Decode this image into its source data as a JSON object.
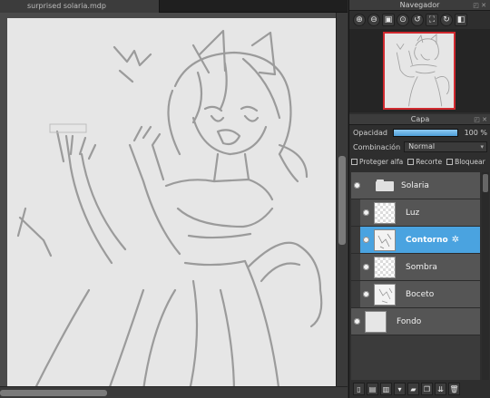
{
  "document": {
    "tab_title": "surprised solaria.mdp"
  },
  "navigator": {
    "title": "Navegador",
    "tools": [
      {
        "name": "zoom-in-icon",
        "glyph": "⊕"
      },
      {
        "name": "zoom-out-icon",
        "glyph": "⊖"
      },
      {
        "name": "fit-window-icon",
        "glyph": "▣"
      },
      {
        "name": "actual-size-icon",
        "glyph": "⊙"
      },
      {
        "name": "rotate-left-icon",
        "glyph": "↺"
      },
      {
        "name": "fullscreen-icon",
        "glyph": "⛶"
      },
      {
        "name": "rotate-right-icon",
        "glyph": "↻"
      },
      {
        "name": "flip-icon",
        "glyph": "◧"
      }
    ]
  },
  "capa": {
    "title": "Capa",
    "opacity_label": "Opacidad",
    "opacity_value": "100 %",
    "opacity_fraction": 1.0,
    "blend_label": "Combinación",
    "blend_value": "Normal",
    "checks": [
      {
        "label": "Proteger alfa",
        "name": "protect-alpha-checkbox"
      },
      {
        "label": "Recorte",
        "name": "clipping-checkbox"
      },
      {
        "label": "Bloquear",
        "name": "lock-checkbox"
      }
    ],
    "layers": [
      {
        "name": "Solaria",
        "type": "folder",
        "selected": false,
        "indent": false
      },
      {
        "name": "Luz",
        "type": "layer",
        "selected": false,
        "indent": true
      },
      {
        "name": "Contorno",
        "type": "layer",
        "selected": true,
        "indent": true
      },
      {
        "name": "Sombra",
        "type": "layer",
        "selected": false,
        "indent": true
      },
      {
        "name": "Boceto",
        "type": "layer",
        "selected": false,
        "indent": true
      },
      {
        "name": "Fondo",
        "type": "layer",
        "selected": false,
        "indent": false
      }
    ],
    "toolbar": [
      {
        "name": "new-layer-icon",
        "glyph": "▯"
      },
      {
        "name": "new-layer-menu-icon",
        "glyph": "▤"
      },
      {
        "name": "new-1bit-layer-icon",
        "glyph": "▥"
      },
      {
        "name": "add-layer-dropdown-icon",
        "glyph": "▾"
      },
      {
        "name": "new-folder-icon",
        "glyph": "▰"
      },
      {
        "name": "duplicate-layer-icon",
        "glyph": "❐"
      },
      {
        "name": "merge-layer-icon",
        "glyph": "⇊"
      },
      {
        "name": "delete-layer-icon",
        "glyph": "🗑"
      }
    ]
  },
  "colors": {
    "selected_layer": "#4aa3e0",
    "navigator_frame": "#d0292f",
    "opacity_fill": "#4f9fd8"
  }
}
